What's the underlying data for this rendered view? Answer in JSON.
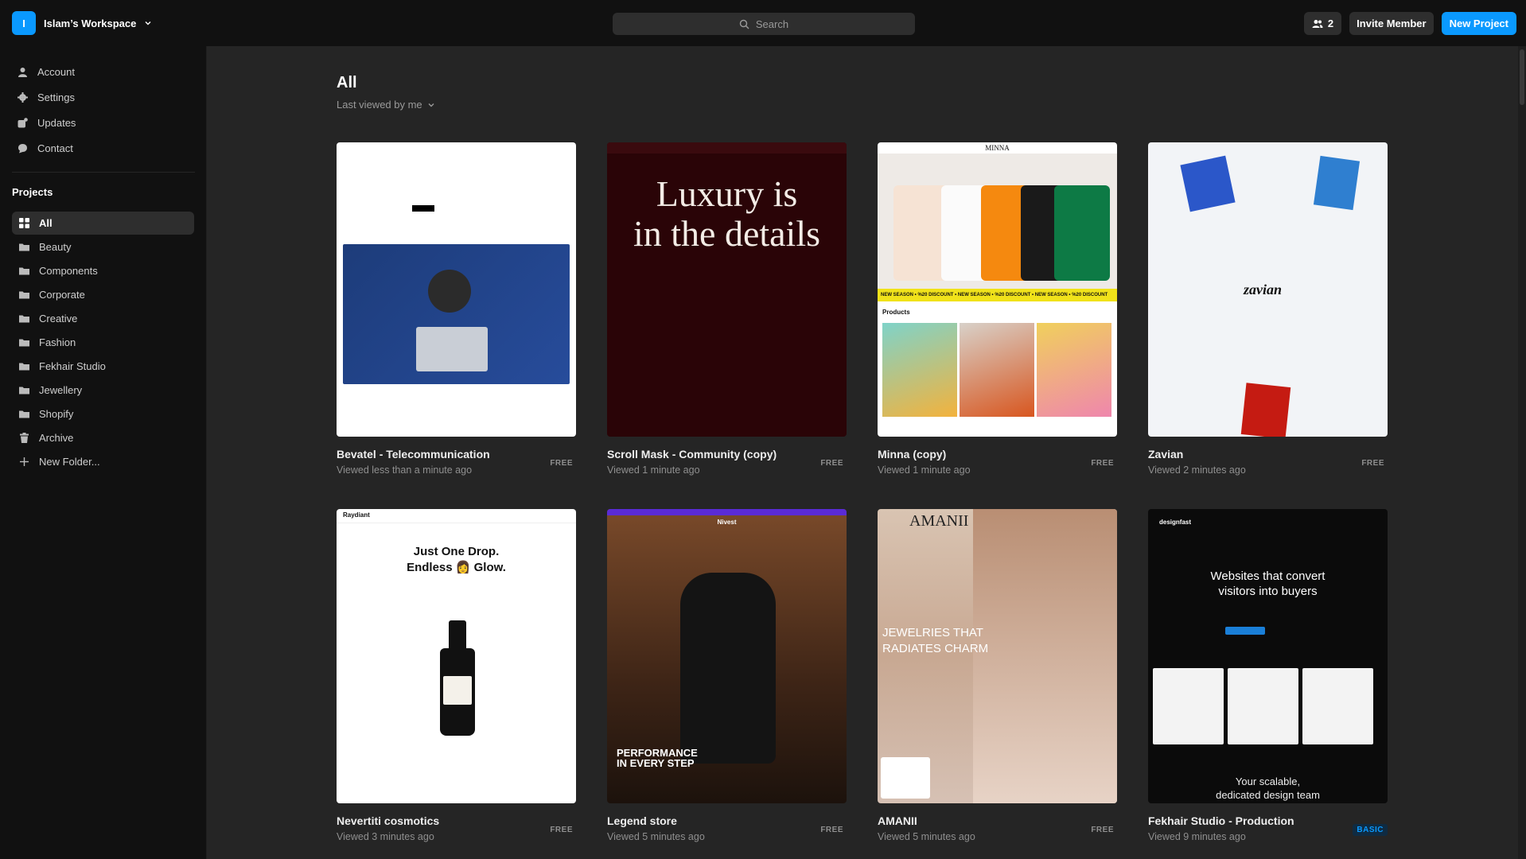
{
  "topbar": {
    "workspace_initial": "I",
    "workspace_name": "Islam’s Workspace",
    "search_placeholder": "Search",
    "member_count": "2",
    "invite_label": "Invite Member",
    "new_project_label": "New Project"
  },
  "sidebar": {
    "nav": [
      {
        "label": "Account",
        "icon": "user-icon"
      },
      {
        "label": "Settings",
        "icon": "gear-icon"
      },
      {
        "label": "Updates",
        "icon": "updates-icon"
      },
      {
        "label": "Contact",
        "icon": "chat-icon"
      }
    ],
    "projects_heading": "Projects",
    "projects": [
      {
        "label": "All",
        "icon": "grid-icon",
        "active": true
      },
      {
        "label": "Beauty",
        "icon": "folder-icon"
      },
      {
        "label": "Components",
        "icon": "folder-icon"
      },
      {
        "label": "Corporate",
        "icon": "folder-icon"
      },
      {
        "label": "Creative",
        "icon": "folder-icon"
      },
      {
        "label": "Fashion",
        "icon": "folder-icon"
      },
      {
        "label": "Fekhair Studio",
        "icon": "folder-icon"
      },
      {
        "label": "Jewellery",
        "icon": "folder-icon"
      },
      {
        "label": "Shopify",
        "icon": "folder-icon"
      },
      {
        "label": "Archive",
        "icon": "trash-icon"
      },
      {
        "label": "New Folder...",
        "icon": "plus-icon"
      }
    ]
  },
  "main": {
    "title": "All",
    "sort_label": "Last viewed by me",
    "cards": [
      {
        "title": "Bevatel - Telecommunication",
        "subtitle": "Viewed less than a minute ago",
        "plan": "FREE"
      },
      {
        "title": "Scroll Mask - Community (copy)",
        "subtitle": "Viewed 1 minute ago",
        "plan": "FREE",
        "thumb_text": "Luxury is\nin the details"
      },
      {
        "title": "Minna (copy)",
        "subtitle": "Viewed 1 minute ago",
        "plan": "FREE",
        "thumb_brand": "MINNA",
        "thumb_section": "Products",
        "thumb_ticker": "NEW SEASON • %20 DISCOUNT • NEW SEASON • %20 DISCOUNT • NEW SEASON • %20 DISCOUNT"
      },
      {
        "title": "Zavian",
        "subtitle": "Viewed 2 minutes ago",
        "plan": "FREE",
        "thumb_logo": "zavian"
      },
      {
        "title": "Nevertiti cosmotics",
        "subtitle": "Viewed 3 minutes ago",
        "plan": "FREE",
        "thumb_brand": "Raydiant",
        "thumb_headline_1": "Just One Drop.",
        "thumb_headline_2": "Endless 👩 Glow."
      },
      {
        "title": "Legend store",
        "subtitle": "Viewed 5 minutes ago",
        "plan": "FREE",
        "thumb_brand": "Nivest",
        "thumb_headline": "PERFORMANCE\nIN EVERY STEP"
      },
      {
        "title": "AMANII",
        "subtitle": "Viewed 5 minutes ago",
        "plan": "FREE",
        "thumb_brand": "AMANII",
        "thumb_headline": "JEWELRIES THAT\nRADIATES CHARM"
      },
      {
        "title": "Fekhair Studio - Production",
        "subtitle": "Viewed 9 minutes ago",
        "plan": "BASIC",
        "thumb_brand": "designfast",
        "thumb_headline": "Websites that convert\nvisitors into buyers",
        "thumb_footer": "Your scalable,\ndedicated design team"
      }
    ]
  },
  "colors": {
    "accent": "#0a99ff",
    "background": "#252525",
    "sidebar": "#111111"
  }
}
